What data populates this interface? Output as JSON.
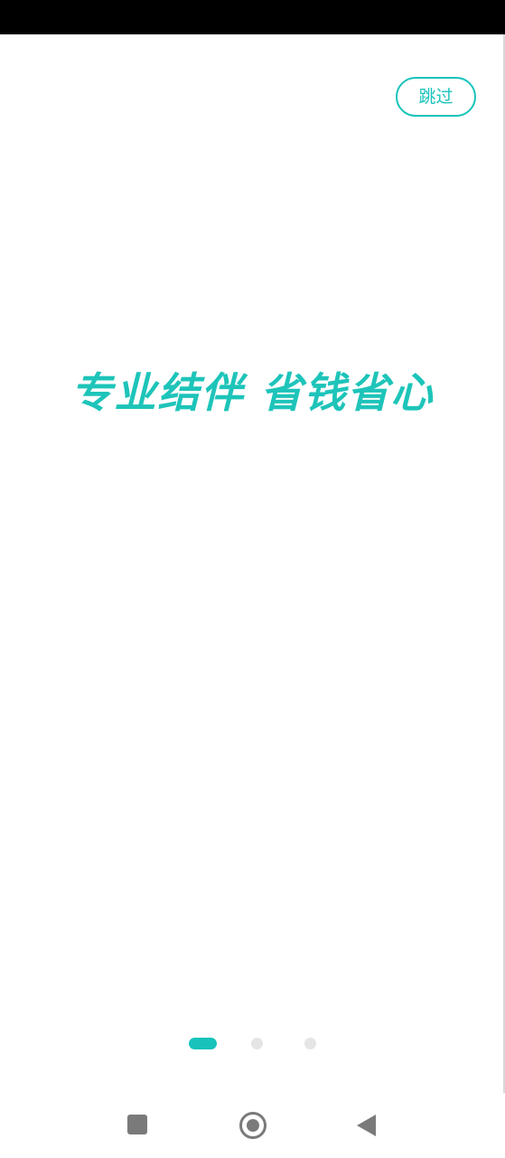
{
  "header": {
    "skip_label": "跳过"
  },
  "main": {
    "slogan": "专业结伴 省钱省心"
  },
  "pager": {
    "total_pages": 3,
    "current_page": 1
  },
  "colors": {
    "accent": "#17c3bb",
    "inactive_dot": "#e5e5e5",
    "status_bar": "#000000",
    "nav_icons": "#7a7a7a"
  },
  "icons": {
    "nav_recents": "square-icon",
    "nav_home": "circle-icon",
    "nav_back": "triangle-back-icon"
  }
}
